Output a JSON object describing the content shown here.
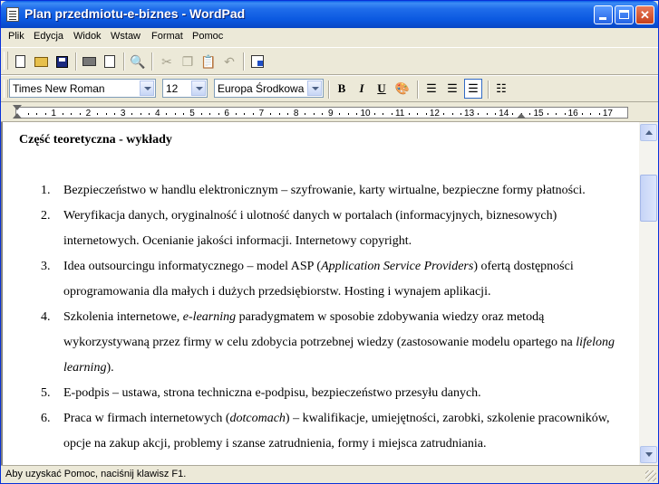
{
  "window": {
    "title": "Plan przedmiotu-e-biznes - WordPad"
  },
  "menu": [
    "Plik",
    "Edycja",
    "Widok",
    "Wstaw",
    "Format",
    "Pomoc"
  ],
  "toolbar": {
    "tools": [
      "new-icon",
      "open-icon",
      "save-icon",
      "print-icon",
      "print-preview-icon",
      "find-icon",
      "cut-icon",
      "copy-icon",
      "paste-icon",
      "undo-icon",
      "date-time-icon"
    ]
  },
  "format_bar": {
    "font": "Times New Roman",
    "size": "12",
    "script": "Europa Środkowa",
    "bold": "B",
    "italic": "I",
    "underline": "U"
  },
  "ruler": {
    "labels": [
      "1",
      "2",
      "3",
      "4",
      "5",
      "6",
      "7",
      "8",
      "9",
      "10",
      "11",
      "12",
      "13",
      "14",
      "15",
      "16",
      "17"
    ]
  },
  "document": {
    "heading": "Część teoretyczna - wykłady",
    "items": [
      {
        "num": "1.",
        "html": "Bezpieczeństwo w handlu elektronicznym – szyfrowanie, karty wirtualne, bezpieczne formy płatności."
      },
      {
        "num": "2.",
        "html": "Weryfikacja danych, oryginalność i ulotność danych w portalach (informacyjnych, biznesowych) internetowych. Ocenianie jakości informacji. Internetowy copyright."
      },
      {
        "num": "3.",
        "html": "Idea outsourcingu informatycznego – model ASP (<em>Application Service Providers</em>) ofertą dostępności oprogramowania dla małych i dużych przedsiębiorstw. Hosting i wynajem aplikacji."
      },
      {
        "num": "4.",
        "html": "Szkolenia internetowe, <em>e-learning</em> paradygmatem w sposobie zdobywania wiedzy oraz metodą wykorzystywaną przez firmy w celu zdobycia potrzebnej wiedzy (zastosowanie modelu opartego na <em>lifelong learning</em>)."
      },
      {
        "num": "5.",
        "html": "E-podpis – ustawa, strona techniczna e-podpisu, bezpieczeństwo przesyłu danych."
      },
      {
        "num": "6.",
        "html": "Praca w firmach internetowych (<em>dotcomach</em>) – kwalifikacje, umiejętności, zarobki, szkolenie pracowników, opcje na zakup akcji, problemy i szanse zatrudnienia, formy i miejsca zatrudniania."
      }
    ]
  },
  "status": {
    "text": "Aby uzyskać Pomoc, naciśnij klawisz F1."
  }
}
